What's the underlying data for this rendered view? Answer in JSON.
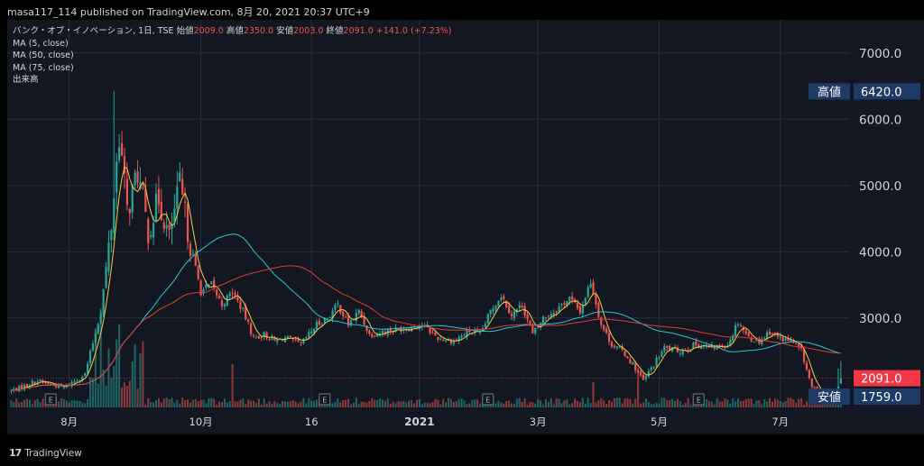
{
  "header": {
    "publisher_line": "masa117_114 published on TradingView.com, 8月 20, 2021 20:37 UTC+9"
  },
  "legend": {
    "symbol_line": "バンク・オブ・イノベーション, 1日, TSE",
    "ohlc": [
      {
        "label": "始値",
        "value": "2009.0"
      },
      {
        "label": "高値",
        "value": "2350.0"
      },
      {
        "label": "安値",
        "value": "2003.0"
      },
      {
        "label": "終値",
        "value": "2091.0"
      }
    ],
    "change": "+141.0 (+7.23%)",
    "indicators": [
      "MA (5, close)",
      "MA (50, close)",
      "MA (75, close)",
      "出来高"
    ]
  },
  "footer": {
    "brand": "TradingView"
  },
  "colors": {
    "up": "#26a69a",
    "down": "#ef5350",
    "ma5": "#f7c948",
    "ma50": "#26c6da",
    "ma75": "#e53935",
    "background": "#131722",
    "label_box": "#1e3a66",
    "last_price": "#f23645"
  },
  "chart_data": {
    "type": "candlestick",
    "x_tick_labels": [
      "8月",
      "10月",
      "16",
      "2021",
      "3月",
      "5月",
      "7月"
    ],
    "y_tick_labels": [
      "7000.0",
      "6000.0",
      "5000.0",
      "4000.0",
      "3000.0"
    ],
    "ylim": [
      1650,
      7500
    ],
    "high_label": {
      "label": "高値",
      "value": "6420.0",
      "price": 6420
    },
    "low_label": {
      "label": "安値",
      "value": "1759.0",
      "price": 1759
    },
    "last_price": {
      "value": "2091.0",
      "price": 2091
    },
    "earnings_markers": [
      "E",
      "E",
      "E",
      "E"
    ],
    "series_names": [
      "MA (5, close)",
      "MA (50, close)",
      "MA (75, close)",
      "出来高"
    ],
    "price_anchors": [
      {
        "t": 0,
        "p": 1900
      },
      {
        "t": 10,
        "p": 2050
      },
      {
        "t": 20,
        "p": 1950
      },
      {
        "t": 28,
        "p": 2150
      },
      {
        "t": 34,
        "p": 3100
      },
      {
        "t": 38,
        "p": 4400
      },
      {
        "t": 41,
        "p": 5800
      },
      {
        "t": 44,
        "p": 4600
      },
      {
        "t": 48,
        "p": 5200
      },
      {
        "t": 52,
        "p": 4300
      },
      {
        "t": 56,
        "p": 4800
      },
      {
        "t": 60,
        "p": 4200
      },
      {
        "t": 64,
        "p": 5000
      },
      {
        "t": 68,
        "p": 4100
      },
      {
        "t": 72,
        "p": 3400
      },
      {
        "t": 76,
        "p": 3500
      },
      {
        "t": 80,
        "p": 3200
      },
      {
        "t": 84,
        "p": 3400
      },
      {
        "t": 88,
        "p": 3100
      },
      {
        "t": 92,
        "p": 2700
      },
      {
        "t": 96,
        "p": 2750
      },
      {
        "t": 100,
        "p": 2650
      },
      {
        "t": 104,
        "p": 2700
      },
      {
        "t": 110,
        "p": 2600
      },
      {
        "t": 116,
        "p": 2900
      },
      {
        "t": 120,
        "p": 3000
      },
      {
        "t": 124,
        "p": 3200
      },
      {
        "t": 128,
        "p": 2900
      },
      {
        "t": 132,
        "p": 3100
      },
      {
        "t": 136,
        "p": 2750
      },
      {
        "t": 142,
        "p": 2800
      },
      {
        "t": 150,
        "p": 2850
      },
      {
        "t": 156,
        "p": 2900
      },
      {
        "t": 162,
        "p": 2700
      },
      {
        "t": 168,
        "p": 2650
      },
      {
        "t": 174,
        "p": 2800
      },
      {
        "t": 178,
        "p": 2750
      },
      {
        "t": 182,
        "p": 3100
      },
      {
        "t": 186,
        "p": 3350
      },
      {
        "t": 190,
        "p": 3050
      },
      {
        "t": 194,
        "p": 3200
      },
      {
        "t": 198,
        "p": 2750
      },
      {
        "t": 202,
        "p": 3000
      },
      {
        "t": 206,
        "p": 3100
      },
      {
        "t": 212,
        "p": 3300
      },
      {
        "t": 216,
        "p": 3100
      },
      {
        "t": 220,
        "p": 3550
      },
      {
        "t": 224,
        "p": 2900
      },
      {
        "t": 228,
        "p": 2600
      },
      {
        "t": 232,
        "p": 2500
      },
      {
        "t": 236,
        "p": 2300
      },
      {
        "t": 240,
        "p": 2050
      },
      {
        "t": 244,
        "p": 2300
      },
      {
        "t": 248,
        "p": 2550
      },
      {
        "t": 254,
        "p": 2500
      },
      {
        "t": 260,
        "p": 2600
      },
      {
        "t": 266,
        "p": 2550
      },
      {
        "t": 272,
        "p": 2600
      },
      {
        "t": 276,
        "p": 2950
      },
      {
        "t": 280,
        "p": 2700
      },
      {
        "t": 284,
        "p": 2650
      },
      {
        "t": 288,
        "p": 2800
      },
      {
        "t": 292,
        "p": 2700
      },
      {
        "t": 296,
        "p": 2650
      },
      {
        "t": 300,
        "p": 2500
      },
      {
        "t": 304,
        "p": 1950
      },
      {
        "t": 308,
        "p": 1850
      },
      {
        "t": 312,
        "p": 1800
      },
      {
        "t": 315,
        "p": 2091
      }
    ]
  }
}
